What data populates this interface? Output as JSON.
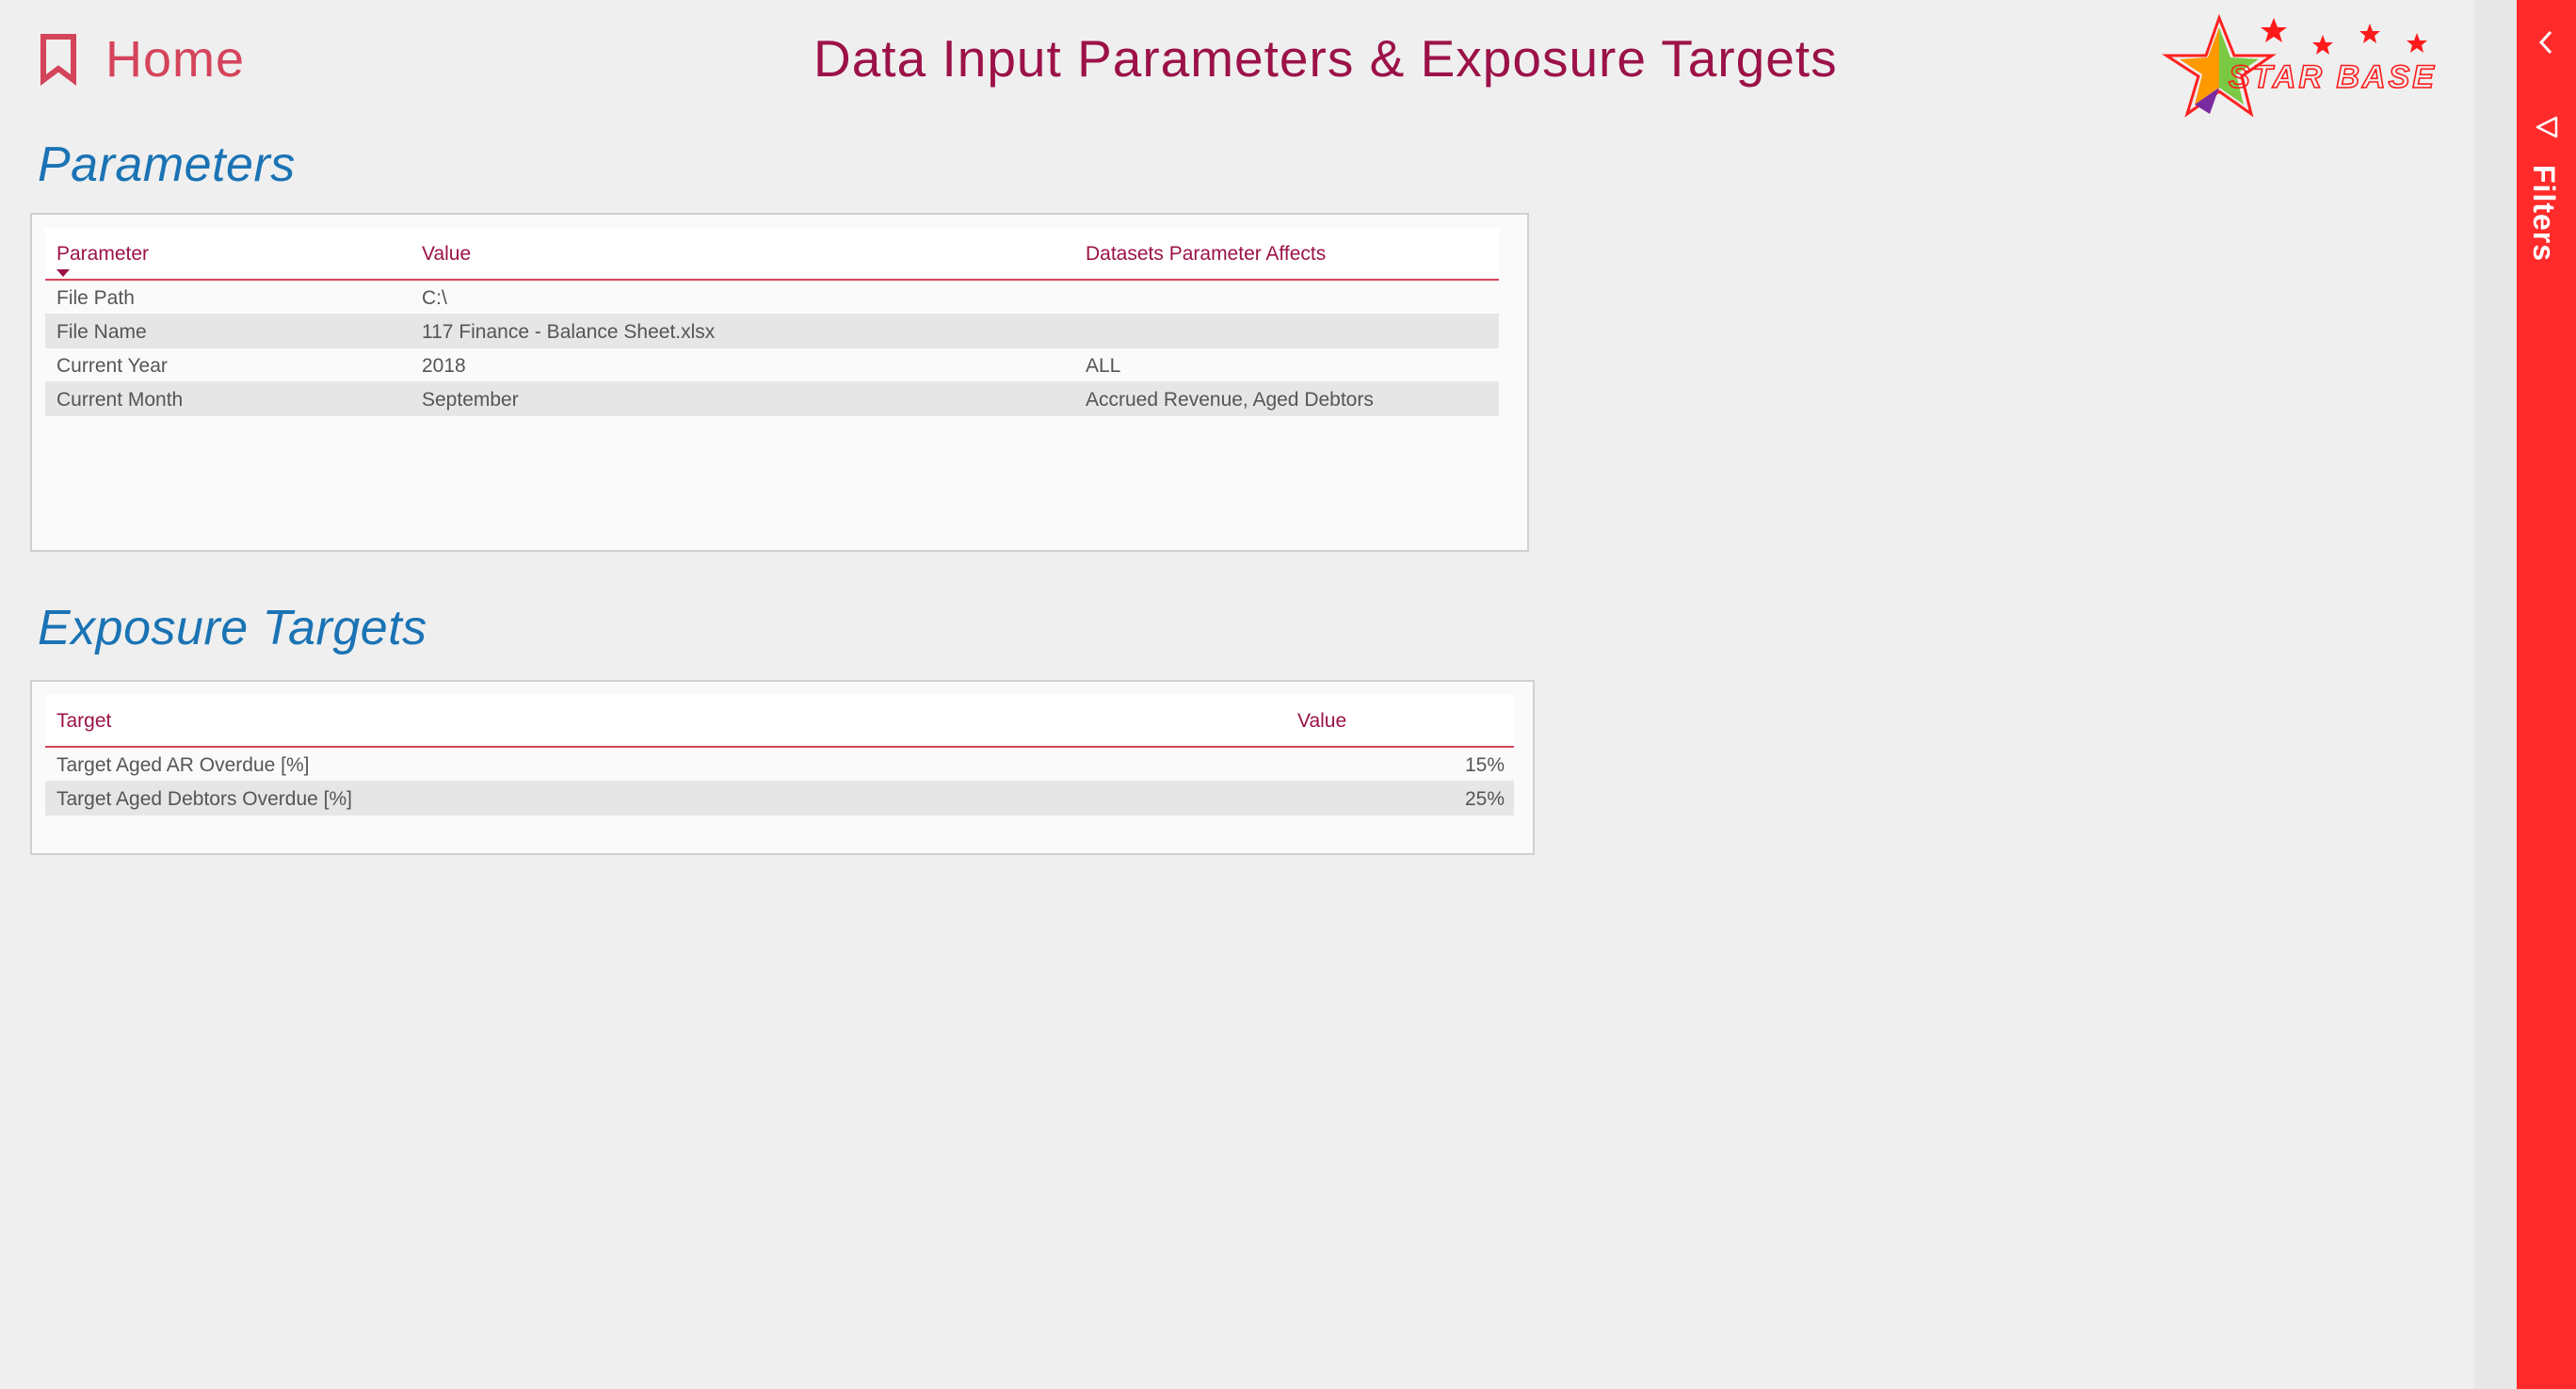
{
  "header": {
    "home_label": "Home",
    "title": "Data Input Parameters & Exposure Targets",
    "logo_text": "STAR BASE"
  },
  "parameters": {
    "section_title": "Parameters",
    "columns": [
      "Parameter",
      "Value",
      "Datasets Parameter Affects"
    ],
    "rows": [
      [
        "File Path",
        "C:\\",
        ""
      ],
      [
        "File Name",
        "117 Finance - Balance Sheet.xlsx",
        ""
      ],
      [
        "Current Year",
        "2018",
        "ALL"
      ],
      [
        "Current Month",
        "September",
        "Accrued Revenue, Aged Debtors"
      ]
    ]
  },
  "exposure_targets": {
    "section_title": "Exposure Targets",
    "columns": [
      "Target",
      "Value"
    ],
    "rows": [
      [
        "Target Aged AR Overdue [%]",
        "15%"
      ],
      [
        "Target Aged Debtors Overdue [%]",
        "25%"
      ]
    ]
  },
  "filters_pane": {
    "label": "Filters"
  },
  "colors": {
    "accent": "#d4445a",
    "title": "#9c1248",
    "section": "#1a73b4",
    "pane": "#ff2b2b"
  }
}
